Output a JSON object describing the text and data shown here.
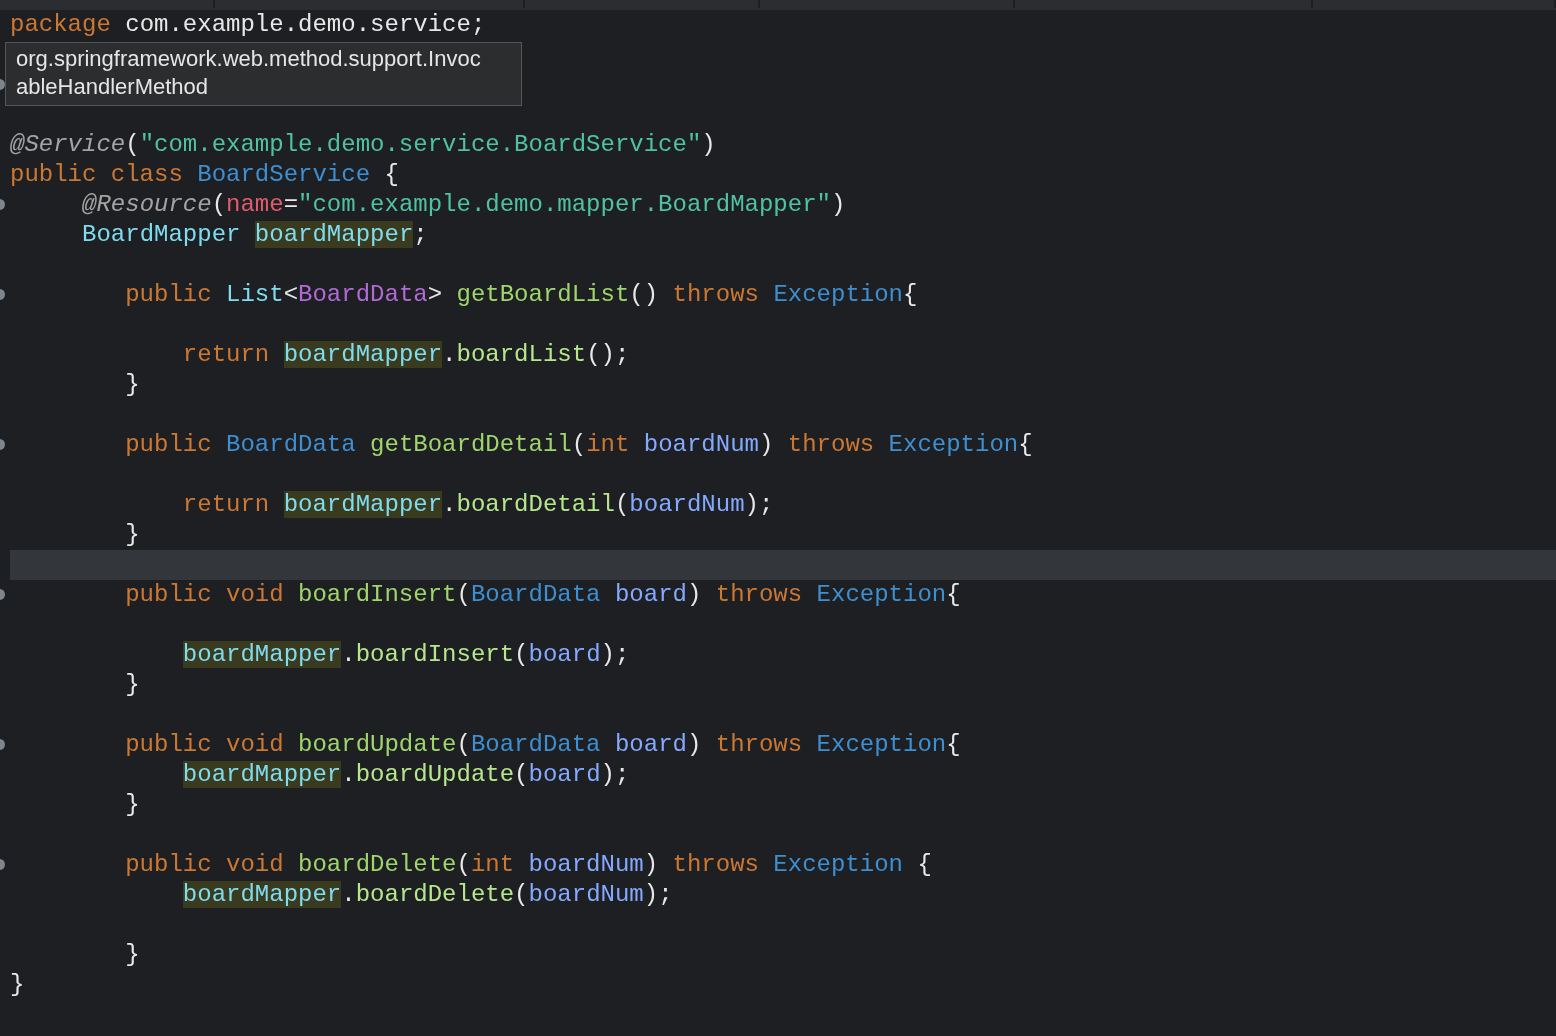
{
  "tooltip": {
    "lines": [
      "org.springframework.web.method.support.Invoc",
      "ableHandlerMethod"
    ]
  },
  "lines": [
    {
      "kind": "code",
      "tokens": [
        {
          "kind": "keyword",
          "text": "package"
        },
        {
          "kind": "plain",
          "text": " com.example.demo.service;"
        }
      ]
    },
    {
      "kind": "blank"
    },
    {
      "kind": "blank",
      "marker": true
    },
    {
      "kind": "blank"
    },
    {
      "kind": "code",
      "tokens": [
        {
          "kind": "annotation",
          "text": "@Service"
        },
        {
          "kind": "plain",
          "text": "("
        },
        {
          "kind": "string",
          "text": "\"com.example.demo.service.BoardService\""
        },
        {
          "kind": "plain",
          "text": ")"
        }
      ]
    },
    {
      "kind": "code",
      "tokens": [
        {
          "kind": "keyword",
          "text": "public class "
        },
        {
          "kind": "class",
          "text": "BoardService"
        },
        {
          "kind": "plain",
          "text": " {"
        }
      ]
    },
    {
      "kind": "code",
      "marker": true,
      "tokens": [
        {
          "kind": "annotation",
          "text": "     @Resource"
        },
        {
          "kind": "plain",
          "text": "("
        },
        {
          "kind": "attr",
          "text": "name"
        },
        {
          "kind": "plain",
          "text": "="
        },
        {
          "kind": "string",
          "text": "\"com.example.demo.mapper.BoardMapper\""
        },
        {
          "kind": "plain",
          "text": ")"
        }
      ]
    },
    {
      "kind": "code",
      "tokens": [
        {
          "kind": "type",
          "text": "     BoardMapper"
        },
        {
          "kind": "field",
          "text": " boardMapper"
        },
        {
          "kind": "plain",
          "text": ";"
        }
      ]
    },
    {
      "kind": "blank"
    },
    {
      "kind": "code",
      "marker": true,
      "tokens": [
        {
          "kind": "keyword",
          "text": "        public "
        },
        {
          "kind": "type",
          "text": "List"
        },
        {
          "kind": "plain",
          "text": "<"
        },
        {
          "kind": "generic",
          "text": "BoardData"
        },
        {
          "kind": "plain",
          "text": "> "
        },
        {
          "kind": "method",
          "text": "getBoardList"
        },
        {
          "kind": "plain",
          "text": "() "
        },
        {
          "kind": "keyword",
          "text": "throws "
        },
        {
          "kind": "class",
          "text": "Exception"
        },
        {
          "kind": "plain",
          "text": "{"
        }
      ]
    },
    {
      "kind": "blank"
    },
    {
      "kind": "code",
      "tokens": [
        {
          "kind": "keyword",
          "text": "            return"
        },
        {
          "kind": "field",
          "text": " boardMapper"
        },
        {
          "kind": "plain",
          "text": "."
        },
        {
          "kind": "call",
          "text": "boardList"
        },
        {
          "kind": "plain",
          "text": "();"
        }
      ]
    },
    {
      "kind": "code",
      "tokens": [
        {
          "kind": "plain",
          "text": "        }"
        }
      ]
    },
    {
      "kind": "blank"
    },
    {
      "kind": "code",
      "marker": true,
      "tokens": [
        {
          "kind": "keyword",
          "text": "        public "
        },
        {
          "kind": "class",
          "text": "BoardData"
        },
        {
          "kind": "method",
          "text": " getBoardDetail"
        },
        {
          "kind": "plain",
          "text": "("
        },
        {
          "kind": "keyword",
          "text": "int "
        },
        {
          "kind": "param",
          "text": "boardNum"
        },
        {
          "kind": "plain",
          "text": ") "
        },
        {
          "kind": "keyword",
          "text": "throws "
        },
        {
          "kind": "class",
          "text": "Exception"
        },
        {
          "kind": "plain",
          "text": "{"
        }
      ]
    },
    {
      "kind": "blank"
    },
    {
      "kind": "code",
      "tokens": [
        {
          "kind": "keyword",
          "text": "            return"
        },
        {
          "kind": "field",
          "text": " boardMapper"
        },
        {
          "kind": "plain",
          "text": "."
        },
        {
          "kind": "call",
          "text": "boardDetail"
        },
        {
          "kind": "plain",
          "text": "("
        },
        {
          "kind": "param",
          "text": "boardNum"
        },
        {
          "kind": "plain",
          "text": ");"
        }
      ]
    },
    {
      "kind": "code",
      "tokens": [
        {
          "kind": "plain",
          "text": "        }"
        }
      ]
    },
    {
      "kind": "blank",
      "current": true
    },
    {
      "kind": "code",
      "marker": true,
      "tokens": [
        {
          "kind": "keyword",
          "text": "        public void "
        },
        {
          "kind": "method",
          "text": "boardInsert"
        },
        {
          "kind": "plain",
          "text": "("
        },
        {
          "kind": "class",
          "text": "BoardData"
        },
        {
          "kind": "param",
          "text": " board"
        },
        {
          "kind": "plain",
          "text": ") "
        },
        {
          "kind": "keyword",
          "text": "throws "
        },
        {
          "kind": "class",
          "text": "Exception"
        },
        {
          "kind": "plain",
          "text": "{"
        }
      ]
    },
    {
      "kind": "blank"
    },
    {
      "kind": "code",
      "tokens": [
        {
          "kind": "field",
          "text": "            boardMapper"
        },
        {
          "kind": "plain",
          "text": "."
        },
        {
          "kind": "call",
          "text": "boardInsert"
        },
        {
          "kind": "plain",
          "text": "("
        },
        {
          "kind": "param",
          "text": "board"
        },
        {
          "kind": "plain",
          "text": ");"
        }
      ]
    },
    {
      "kind": "code",
      "tokens": [
        {
          "kind": "plain",
          "text": "        }"
        }
      ]
    },
    {
      "kind": "blank"
    },
    {
      "kind": "code",
      "marker": true,
      "tokens": [
        {
          "kind": "keyword",
          "text": "        public void "
        },
        {
          "kind": "method",
          "text": "boardUpdate"
        },
        {
          "kind": "plain",
          "text": "("
        },
        {
          "kind": "class",
          "text": "BoardData"
        },
        {
          "kind": "param",
          "text": " board"
        },
        {
          "kind": "plain",
          "text": ") "
        },
        {
          "kind": "keyword",
          "text": "throws "
        },
        {
          "kind": "class",
          "text": "Exception"
        },
        {
          "kind": "plain",
          "text": "{"
        }
      ]
    },
    {
      "kind": "code",
      "tokens": [
        {
          "kind": "field",
          "text": "            boardMapper"
        },
        {
          "kind": "plain",
          "text": "."
        },
        {
          "kind": "call",
          "text": "boardUpdate"
        },
        {
          "kind": "plain",
          "text": "("
        },
        {
          "kind": "param",
          "text": "board"
        },
        {
          "kind": "plain",
          "text": ");"
        }
      ]
    },
    {
      "kind": "code",
      "tokens": [
        {
          "kind": "plain",
          "text": "        }"
        }
      ]
    },
    {
      "kind": "blank"
    },
    {
      "kind": "code",
      "marker": true,
      "tokens": [
        {
          "kind": "keyword",
          "text": "        public void "
        },
        {
          "kind": "method",
          "text": "boardDelete"
        },
        {
          "kind": "plain",
          "text": "("
        },
        {
          "kind": "keyword",
          "text": "int "
        },
        {
          "kind": "param",
          "text": "boardNum"
        },
        {
          "kind": "plain",
          "text": ") "
        },
        {
          "kind": "keyword",
          "text": "throws "
        },
        {
          "kind": "class",
          "text": "Exception"
        },
        {
          "kind": "plain",
          "text": " {"
        }
      ]
    },
    {
      "kind": "code",
      "tokens": [
        {
          "kind": "field",
          "text": "            boardMapper"
        },
        {
          "kind": "plain",
          "text": "."
        },
        {
          "kind": "call",
          "text": "boardDelete"
        },
        {
          "kind": "plain",
          "text": "("
        },
        {
          "kind": "param",
          "text": "boardNum"
        },
        {
          "kind": "plain",
          "text": ");"
        }
      ]
    },
    {
      "kind": "blank"
    },
    {
      "kind": "code",
      "tokens": [
        {
          "kind": "plain",
          "text": "        }"
        }
      ]
    },
    {
      "kind": "code",
      "tokens": [
        {
          "kind": "plain",
          "text": "}"
        }
      ]
    }
  ]
}
